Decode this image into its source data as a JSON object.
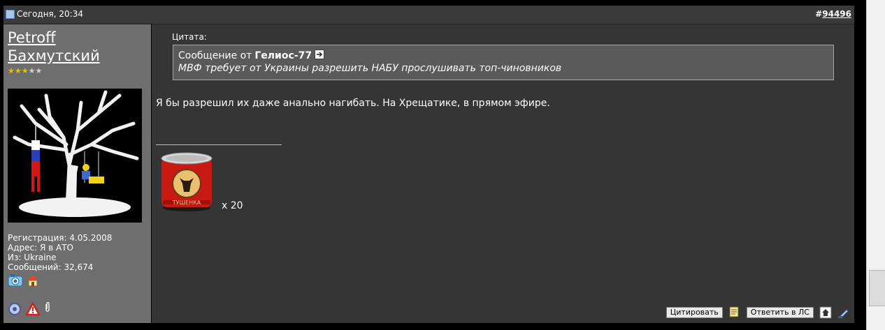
{
  "post": {
    "date": "Сегодня, 20:34",
    "number_prefix": "#",
    "number": "94496"
  },
  "user": {
    "name": "Petroff Бахмутский",
    "rating": 3,
    "rating_max": 5,
    "info": [
      "Регистрация: 4.05.2008",
      "Адрес: Я в АТО",
      "Из: Ukraine",
      "Сообщений: 32,674"
    ]
  },
  "quote": {
    "label": "Цитата:",
    "source_prefix": "Сообщение от",
    "author": "Гелиос-77",
    "text": "МВФ требует от Украины разрешить НАБУ прослушивать топ-чиновников"
  },
  "message": {
    "text": "Я бы разрешил их даже анально нагибать. На Хрещатике, в прямом эфире."
  },
  "signature": {
    "can_label": "ТУШЕНКА",
    "multiplier": "x 20"
  },
  "buttons": {
    "quote": "Цитировать",
    "reply_pm": "Ответить в ЛС"
  },
  "colors": {
    "sidebar": "#6e6e6e",
    "content": "#353535",
    "header": "#3a3a3a",
    "star": "#e6c200"
  }
}
